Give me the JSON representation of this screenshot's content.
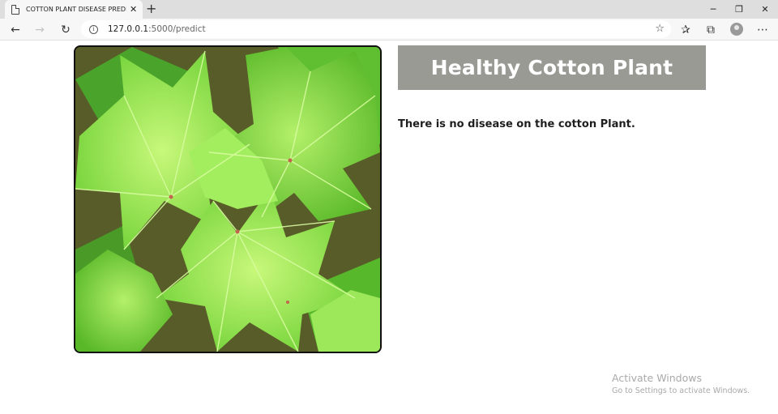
{
  "browser": {
    "tab_title": "COTTON PLANT DISEASE PREDIC",
    "url_host": "127.0.0.1",
    "url_path": ":5000/predict",
    "new_tab_symbol": "+",
    "icons": [
      "page-icon",
      "close-icon",
      "back-icon",
      "forward-icon",
      "refresh-icon",
      "info-icon",
      "favorite-star-icon",
      "favorites-icon",
      "collections-icon",
      "profile-avatar-icon",
      "more-icon",
      "minimize-icon",
      "restore-icon",
      "window-close-icon"
    ]
  },
  "result": {
    "title": "Healthy Cotton Plant",
    "description": "There is no disease on the cotton Plant."
  },
  "watermark": {
    "line1": "Activate Windows",
    "line2": "Go to Settings to activate Windows."
  },
  "colors": {
    "result_box": "#989a93",
    "leaf_light": "#a8f062",
    "leaf_dark": "#5ec22a",
    "soil": "#5a4a30"
  }
}
